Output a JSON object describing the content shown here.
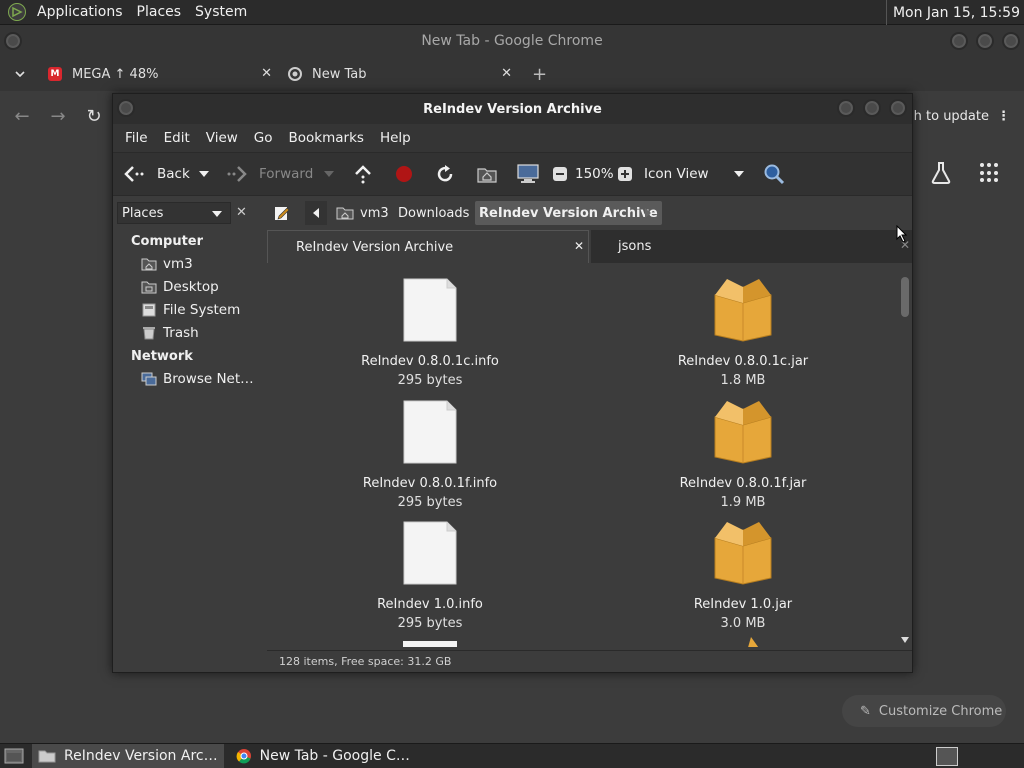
{
  "top_panel": {
    "menus": [
      "Applications",
      "Places",
      "System"
    ],
    "clock": "Mon Jan 15, 15:59"
  },
  "chrome": {
    "window_title": "New Tab - Google Chrome",
    "tabs": [
      {
        "label": "MEGA ↑ 48%",
        "icon": "mega-icon"
      },
      {
        "label": "New Tab",
        "icon": "chrome-icon"
      }
    ],
    "relaunch_label": "nch to update",
    "customize_label": "Customize Chrome"
  },
  "caja": {
    "window_title": "ReIndev Version Archive",
    "menus": [
      "File",
      "Edit",
      "View",
      "Go",
      "Bookmarks",
      "Help"
    ],
    "toolbar": {
      "back": "Back",
      "forward": "Forward",
      "zoom": "150%",
      "view_mode": "Icon View"
    },
    "places_label": "Places",
    "breadcrumbs": [
      "vm3",
      "Downloads",
      "ReIndev Version Archive"
    ],
    "sidebar": {
      "computer_heading": "Computer",
      "computer_items": [
        "vm3",
        "Desktop",
        "File System",
        "Trash"
      ],
      "network_heading": "Network",
      "network_items": [
        "Browse Net…"
      ]
    },
    "tabs": [
      "ReIndev Version Archive",
      "jsons"
    ],
    "files": [
      {
        "name": "ReIndev 0.8.0.1c.info",
        "size": "295 bytes",
        "type": "text"
      },
      {
        "name": "ReIndev 0.8.0.1c.jar",
        "size": "1.8 MB",
        "type": "jar"
      },
      {
        "name": "ReIndev 0.8.0.1f.info",
        "size": "295 bytes",
        "type": "text"
      },
      {
        "name": "ReIndev 0.8.0.1f.jar",
        "size": "1.9 MB",
        "type": "jar"
      },
      {
        "name": "ReIndev 1.0.info",
        "size": "295 bytes",
        "type": "text"
      },
      {
        "name": "ReIndev 1.0.jar",
        "size": "3.0 MB",
        "type": "jar"
      }
    ],
    "status": "128 items, Free space: 31.2 GB"
  },
  "taskbar": {
    "tasks": [
      {
        "label": "ReIndev Version Arc…",
        "icon": "folder-icon"
      },
      {
        "label": "New Tab - Google C…",
        "icon": "chrome-icon"
      }
    ]
  }
}
